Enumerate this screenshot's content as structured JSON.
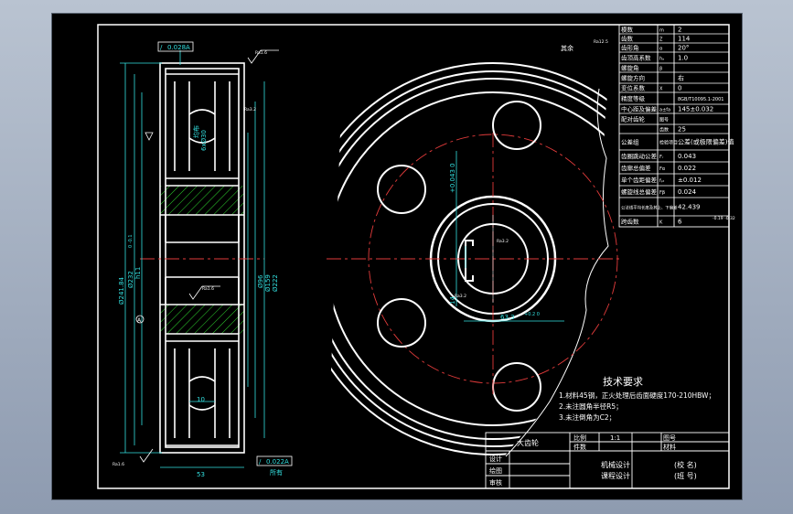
{
  "side_view": {
    "tol_top_box": [
      "/",
      "0.028",
      "A"
    ],
    "tol_bottom_box": [
      "/",
      "0.022",
      "A"
    ],
    "rough_top": "Ra1.6",
    "rough_right": "Ra3.2",
    "rough_bottom": "Ra1.6",
    "rough_mid": "Ra1.6",
    "datum": "A",
    "dim_da": "Ø241.84",
    "dim_sub": "0 -0.1",
    "dim_d": "Ø232",
    "dim_sub2": "h11",
    "dim_sub3": "0 -0.1",
    "dim_hub": "Ø96",
    "dim_hub2": "Ø159",
    "dim_df": "Ø222",
    "dim_hole": "6xØ30",
    "dim_hole2": "均布",
    "dim_width": "53",
    "dim_web": "10",
    "bottom_note": "所有"
  },
  "front_view": {
    "rough_all": "其余",
    "rough_all_val": "Ra12.5",
    "keyway_width": "14",
    "keyway_tol": "+0.043 0",
    "keyway_depth": "63.3",
    "keyway_depth_tol": "+0.2 0",
    "rough_key": "Ra3.2",
    "rough_key2": "Ra3.2"
  },
  "param_table": {
    "rows": [
      {
        "label": "模数",
        "sym": "m",
        "val": "2"
      },
      {
        "label": "齿数",
        "sym": "Z",
        "val": "114"
      },
      {
        "label": "齿形角",
        "sym": "α",
        "val": "20°"
      },
      {
        "label": "齿顶高系数",
        "sym": "hₐ",
        "val": "1.0"
      },
      {
        "label": "螺旋角",
        "sym": "β",
        "val": ""
      },
      {
        "label": "螺旋方向",
        "sym": "",
        "val": "右"
      },
      {
        "label": "变位系数",
        "sym": "X",
        "val": "0"
      },
      {
        "label": "精度等级",
        "sym": "",
        "val": "8GB/T10095.1-2001"
      },
      {
        "label": "中心距及偏差",
        "sym": "a±fa",
        "val": "145±0.032"
      },
      {
        "label": "配对齿轮",
        "sym": "图号",
        "val": ""
      },
      {
        "label": "",
        "sym": "齿数",
        "val": "25"
      },
      {
        "label": "公差组",
        "sym": "检验项目",
        "val": "公差(或极限偏差)值"
      },
      {
        "label": "齿圈跳动公差",
        "sym": "Fᵣ",
        "val": "0.043"
      },
      {
        "label": "齿廓总偏差",
        "sym": "Fα",
        "val": "0.022"
      },
      {
        "label": "单个齿距偏差",
        "sym": "fₚₜ",
        "val": "±0.012"
      },
      {
        "label": "螺旋线总偏差",
        "sym": "Fβ",
        "val": "0.024"
      },
      {
        "label": "公法线平均长度及其上、下偏差",
        "sym": "",
        "val": "42.439"
      },
      {
        "label": "跨齿数",
        "sym": "K",
        "val": "6"
      }
    ],
    "wk_tol": "-0.19 -0.32"
  },
  "tech_req": {
    "title": "技术要求",
    "items": [
      "1.材料45钢，正火处理后齿面硬度170-210HBW；",
      "2.未注圆角半径R5；",
      "3.未注倒角为C2；"
    ]
  },
  "title_block": {
    "part_name": "大齿轮",
    "scale_label": "比例",
    "scale_val": "1:1",
    "drawing_no": "图号",
    "qty_label": "件数",
    "material_label": "材料",
    "designer": "设计",
    "drawn": "绘图",
    "checked": "审核",
    "course1": "机械设计",
    "course2": "课程设计",
    "school": "(校 名)",
    "class": "(班 号)"
  }
}
